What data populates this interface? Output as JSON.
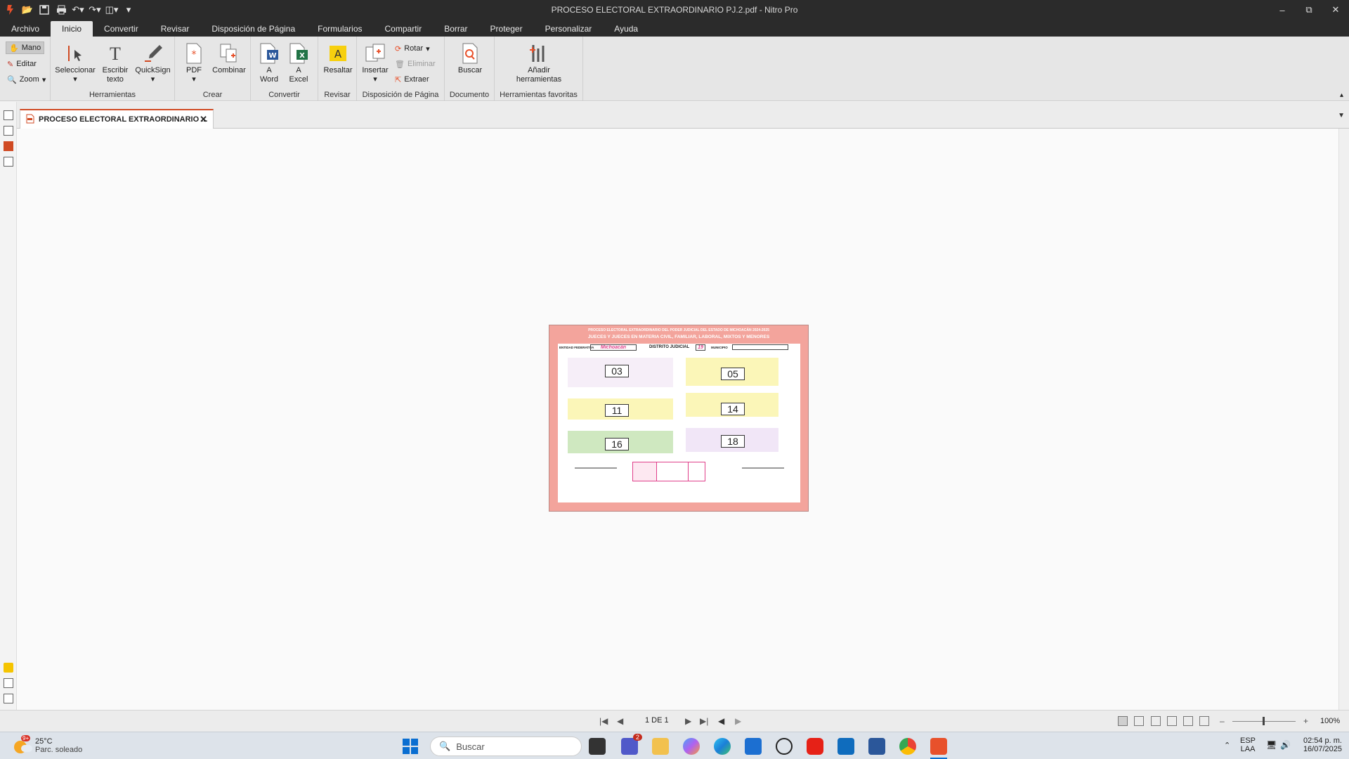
{
  "window": {
    "title": "PROCESO ELECTORAL EXTRAORDINARIO PJ.2.pdf - Nitro Pro"
  },
  "menu": {
    "tabs": [
      "Archivo",
      "Inicio",
      "Convertir",
      "Revisar",
      "Disposición de Página",
      "Formularios",
      "Compartir",
      "Borrar",
      "Proteger",
      "Personalizar",
      "Ayuda"
    ],
    "active": "Inicio"
  },
  "ribbon": {
    "mode": {
      "hand": "Mano",
      "edit": "Editar",
      "zoom": "Zoom"
    },
    "herramientas": {
      "label": "Herramientas",
      "select": "Seleccionar",
      "type_line1": "Escribir",
      "type_line2": "texto",
      "quicksign": "QuickSign"
    },
    "crear": {
      "label": "Crear",
      "pdf": "PDF",
      "combine": "Combinar"
    },
    "convertir": {
      "label": "Convertir",
      "word_line1": "A",
      "word_line2": "Word",
      "excel_line1": "A",
      "excel_line2": "Excel"
    },
    "revisar": {
      "label": "Revisar",
      "highlight": "Resaltar"
    },
    "disposicion": {
      "label": "Disposición de Página",
      "insert": "Insertar",
      "rotate": "Rotar",
      "delete": "Eliminar",
      "extract": "Extraer"
    },
    "documento": {
      "label": "Documento",
      "search": "Buscar"
    },
    "favoritas": {
      "label": "Herramientas favoritas",
      "add_line1": "Añadir",
      "add_line2": "herramientas"
    }
  },
  "document": {
    "tab_title": "PROCESO ELECTORAL EXTRAORDINARIO ...",
    "ballot": {
      "header1": "PROCESO ELECTORAL EXTRAORDINARIO DEL PODER JUDICIAL DEL ESTADO DE MICHOACÁN 2024-2025",
      "header2": "JUECES Y JUECES EN MATERIA CIVIL, FAMILIAR, LABORAL, MIXTOS Y MENORES",
      "entidad_label": "ENTIDAD FEDERATIVA",
      "entidad_value": "Michoacán",
      "distrito_label": "DISTRITO JUDICIAL",
      "distrito_value": "19",
      "municipio_label": "MUNICIPIO",
      "numbers": [
        "03",
        "05",
        "11",
        "14",
        "16",
        "18"
      ]
    }
  },
  "status": {
    "page_indicator": "1 DE 1",
    "zoom": "100%"
  },
  "taskbar": {
    "temperature": "25°C",
    "weather_desc": "Parc. soleado",
    "weather_badge": "9+",
    "search_placeholder": "Buscar",
    "teams_badge": "2",
    "lang1": "ESP",
    "lang2": "LAA",
    "time": "02:54 p. m.",
    "date": "16/07/2025"
  }
}
